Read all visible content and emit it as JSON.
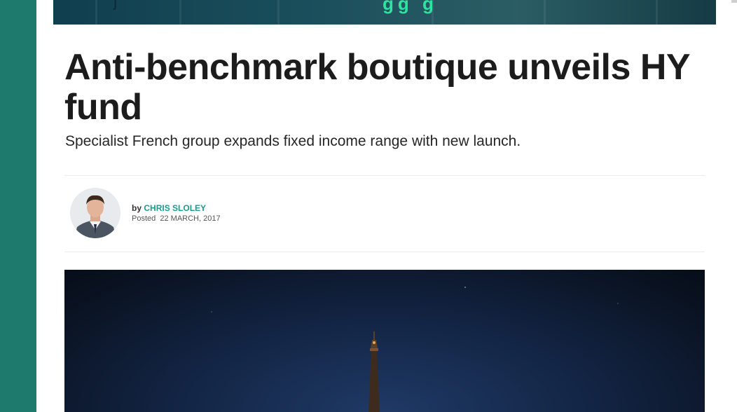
{
  "colors": {
    "left_rail": "#1f7a6e",
    "author_link": "#1b9b8c",
    "headline": "#1c1c1c"
  },
  "article": {
    "headline": "Anti-benchmark boutique unveils HY fund",
    "standfirst": "Specialist French group expands fixed income range with new launch.",
    "byline_prefix": "by",
    "author": "CHRIS SLOLEY",
    "posted_label": "Posted",
    "posted_date": "22 MARCH, 2017"
  },
  "icons": {
    "avatar": "author-photo",
    "hero": "eiffel-tower-night-photo"
  }
}
